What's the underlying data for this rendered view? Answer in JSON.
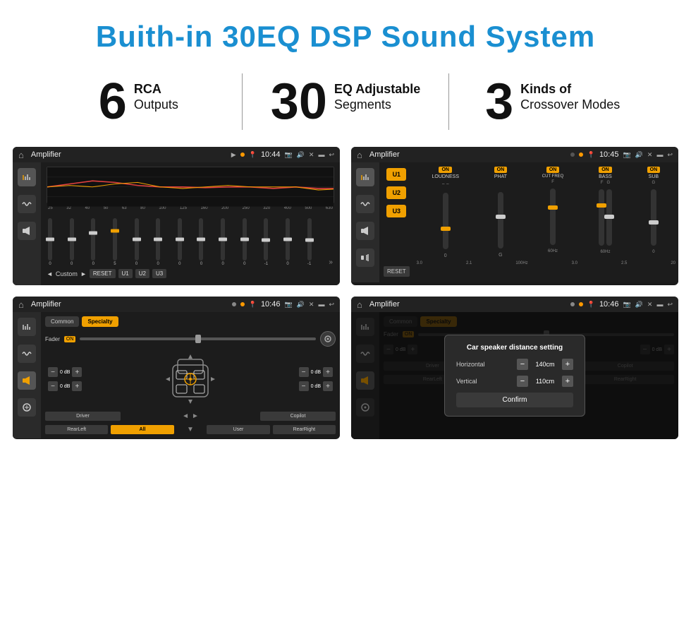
{
  "page": {
    "title": "Buith-in 30EQ DSP Sound System"
  },
  "stats": [
    {
      "number": "6",
      "label_main": "RCA",
      "label_sub": "Outputs"
    },
    {
      "number": "30",
      "label_main": "EQ Adjustable",
      "label_sub": "Segments"
    },
    {
      "number": "3",
      "label_main": "Kinds of",
      "label_sub": "Crossover Modes"
    }
  ],
  "screens": [
    {
      "id": "screen1",
      "status_title": "Amplifier",
      "status_time": "10:44",
      "type": "eq"
    },
    {
      "id": "screen2",
      "status_title": "Amplifier",
      "status_time": "10:45",
      "type": "amp2"
    },
    {
      "id": "screen3",
      "status_title": "Amplifier",
      "status_time": "10:46",
      "type": "speaker"
    },
    {
      "id": "screen4",
      "status_title": "Amplifier",
      "status_time": "10:46",
      "type": "speaker_dialog"
    }
  ],
  "eq_screen": {
    "freq_labels": [
      "25",
      "32",
      "40",
      "50",
      "63",
      "80",
      "100",
      "125",
      "160",
      "200",
      "250",
      "320",
      "400",
      "500",
      "630"
    ],
    "values": [
      "0",
      "0",
      "0",
      "5",
      "0",
      "0",
      "0",
      "0",
      "0",
      "0",
      "-1",
      "0",
      "-1"
    ],
    "preset_label": "Custom",
    "buttons": [
      "RESET",
      "U1",
      "U2",
      "U3"
    ]
  },
  "amp2_screen": {
    "u_buttons": [
      "U1",
      "U2",
      "U3"
    ],
    "controls": [
      "LOUDNESS",
      "PHAT",
      "CUT FREQ",
      "BASS",
      "SUB"
    ],
    "reset_label": "RESET"
  },
  "speaker_screen": {
    "tabs": [
      "Common",
      "Specialty"
    ],
    "fader_label": "Fader",
    "positions": [
      "Driver",
      "RearLeft",
      "All",
      "User",
      "RearRight",
      "Copilot"
    ],
    "db_values": [
      "0 dB",
      "0 dB",
      "0 dB",
      "0 dB"
    ]
  },
  "dialog": {
    "title": "Car speaker distance setting",
    "horizontal_label": "Horizontal",
    "horizontal_value": "140cm",
    "vertical_label": "Vertical",
    "vertical_value": "110cm",
    "confirm_label": "Confirm"
  }
}
